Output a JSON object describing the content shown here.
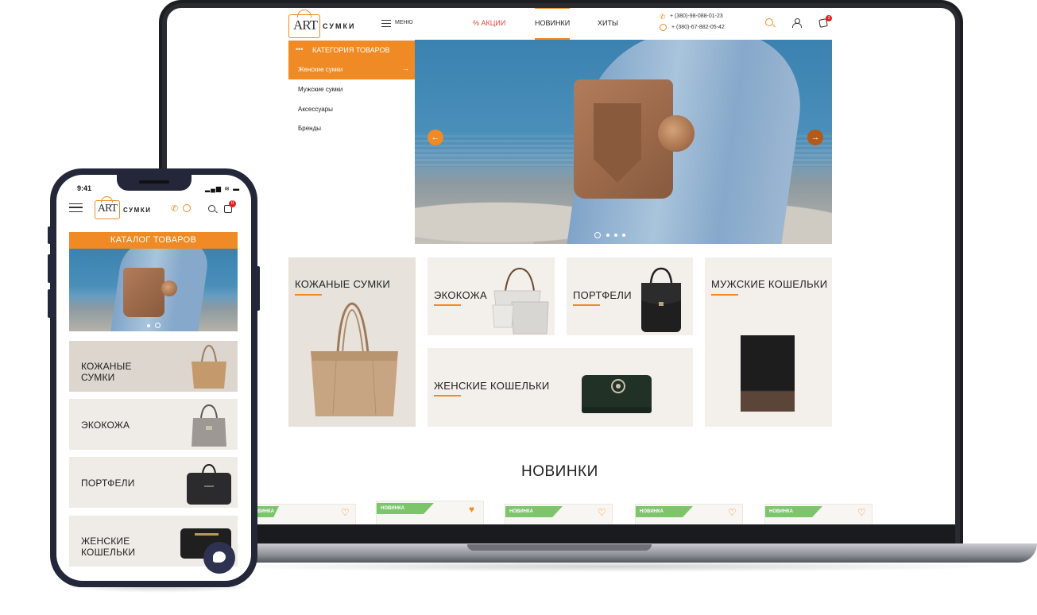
{
  "desktop": {
    "logo": {
      "art": "ART",
      "word": "СУМКИ"
    },
    "menu_label": "МЕНЮ",
    "nav": {
      "sale": "% АКЦИИ",
      "new": "НОВИНКИ",
      "hits": "ХИТЫ"
    },
    "phones": [
      "+ (380)-98-088-01-23",
      "+ (380)-67-882-05-42"
    ],
    "cart_count": "3",
    "catalog": {
      "header": "КАТЕГОРИЯ ТОВАРОВ",
      "dots": "•••",
      "items": [
        "Женские сумки",
        "Мужские сумки",
        "Аксессуары",
        "Бренды"
      ],
      "active_arrow": "→"
    },
    "hero": {
      "prev": "←",
      "next": "→",
      "slides": 4,
      "active_slide": 1
    },
    "categories": [
      {
        "title": "КОЖАНЫЕ СУМКИ"
      },
      {
        "title": "ЭКОКОЖА"
      },
      {
        "title": "ПОРТФЕЛИ"
      },
      {
        "title": "МУЖСКИЕ КОШЕЛЬКИ"
      },
      {
        "title": "ЖЕНСКИЕ КОШЕЛЬКИ"
      }
    ],
    "section_title": "НОВИНКИ",
    "products": [
      {
        "badge": "НОВИНКА",
        "favorite": false
      },
      {
        "badge": "НОВИНКА",
        "favorite": true
      },
      {
        "badge": "НОВИНКА",
        "favorite": false
      },
      {
        "badge": "НОВИНКА",
        "favorite": false
      },
      {
        "badge": "НОВИНКА",
        "favorite": false
      }
    ],
    "icons": {
      "heart_empty": "♡",
      "heart_full": "♥",
      "phone": "✆"
    }
  },
  "mobile": {
    "time": "9:41",
    "status": "▂▄▆ ≋ ▬",
    "logo": {
      "art": "ART",
      "word": "СУМКИ"
    },
    "cart_count": "0",
    "catalog_button": "КАТАЛОГ ТОВАРОВ",
    "tiles": [
      {
        "title": "КОЖАНЫЕ СУМКИ"
      },
      {
        "title": "ЭКОКОЖА"
      },
      {
        "title": "ПОРТФЕЛИ"
      },
      {
        "title": "ЖЕНСКИЕ КОШЕЛЬКИ"
      }
    ],
    "hero_slides": 2,
    "hero_active": 2
  },
  "colors": {
    "accent": "#f08a24",
    "sale": "#e2483a",
    "badge_green": "#7cc56b",
    "tile_bg": "#f3efea",
    "device_dark": "#24263a"
  }
}
